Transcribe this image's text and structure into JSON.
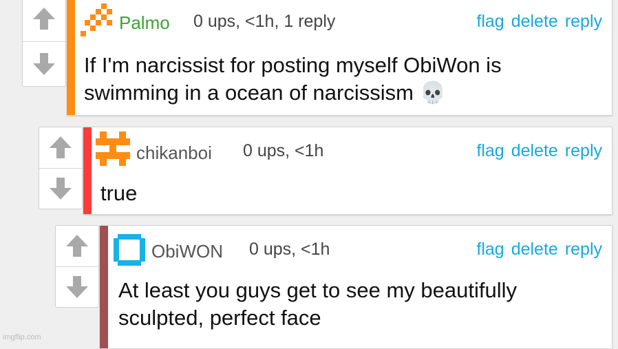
{
  "comments": [
    {
      "username": "Palmo",
      "meta": "0 ups, <1h, 1 reply",
      "actions": [
        "flag",
        "delete",
        "reply"
      ],
      "text_lines": [
        "If I'm narcissist for posting myself ObiWon is",
        "swimming in a ocean of narcissism 💀"
      ],
      "bar_color": "#ff8c14",
      "username_color": "#3aa335",
      "avatar_color": "#ff8c14"
    },
    {
      "username": "chikanboi",
      "meta": "0 ups, <1h",
      "actions": [
        "flag",
        "delete",
        "reply"
      ],
      "text_lines": [
        "true"
      ],
      "bar_color": "#ff3a3a",
      "username_color": "#555555",
      "avatar_color": "#ff8c14"
    },
    {
      "username": "ObiWON",
      "meta": "0 ups, <1h",
      "actions": [
        "flag",
        "delete",
        "reply"
      ],
      "text_lines": [
        "At least you guys get to see my beautifully",
        "sculpted, perfect face"
      ],
      "bar_color": "#a05050",
      "username_color": "#555555",
      "avatar_color": "#19b2e6"
    }
  ],
  "watermark": "imgflip.com",
  "colors": {
    "link": "#17a9dc",
    "arrow": "#a9a9a9"
  }
}
